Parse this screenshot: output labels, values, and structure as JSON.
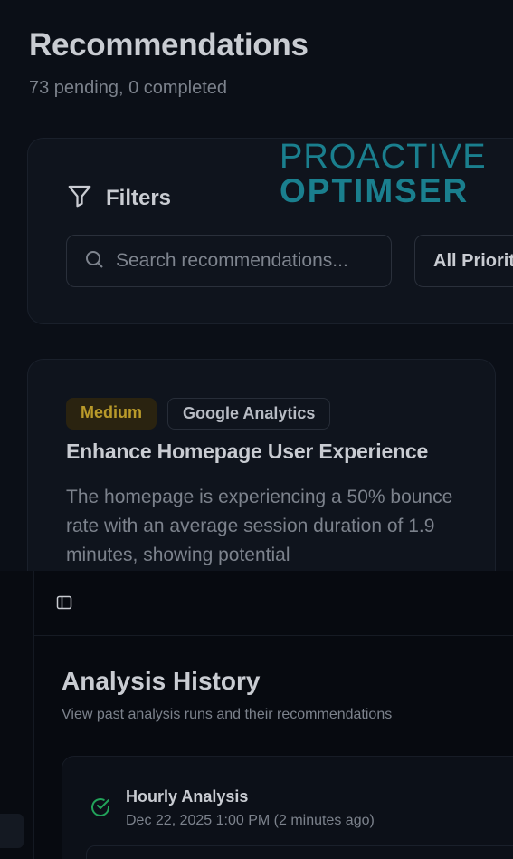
{
  "page": {
    "title": "Recommendations",
    "subtitle": "73 pending, 0 completed"
  },
  "logo": {
    "line1": "PROACTIVE",
    "line2": "OPTIMSER",
    "color": "#1a7f8e"
  },
  "filters": {
    "label": "Filters",
    "icon": "filter-icon",
    "search_placeholder": "Search recommendations...",
    "priority_selected": "All Priorities"
  },
  "recommendation": {
    "priority_badge": "Medium",
    "source_badge": "Google Analytics",
    "title": "Enhance Homepage User Experience",
    "description": "The homepage is experiencing a 50% bounce rate with an average session duration of 1.9 minutes, showing potential"
  },
  "history_panel": {
    "toggle_icon": "sidebar-toggle-icon",
    "title": "Analysis History",
    "subtitle": "View past analysis runs and their recommendations",
    "runs": [
      {
        "name": "Hourly Analysis",
        "date": "Dec 22, 2025 1:00 PM (2 minutes ago)",
        "status_icon": "check-circle-icon",
        "status_color": "#22a35a"
      }
    ]
  }
}
